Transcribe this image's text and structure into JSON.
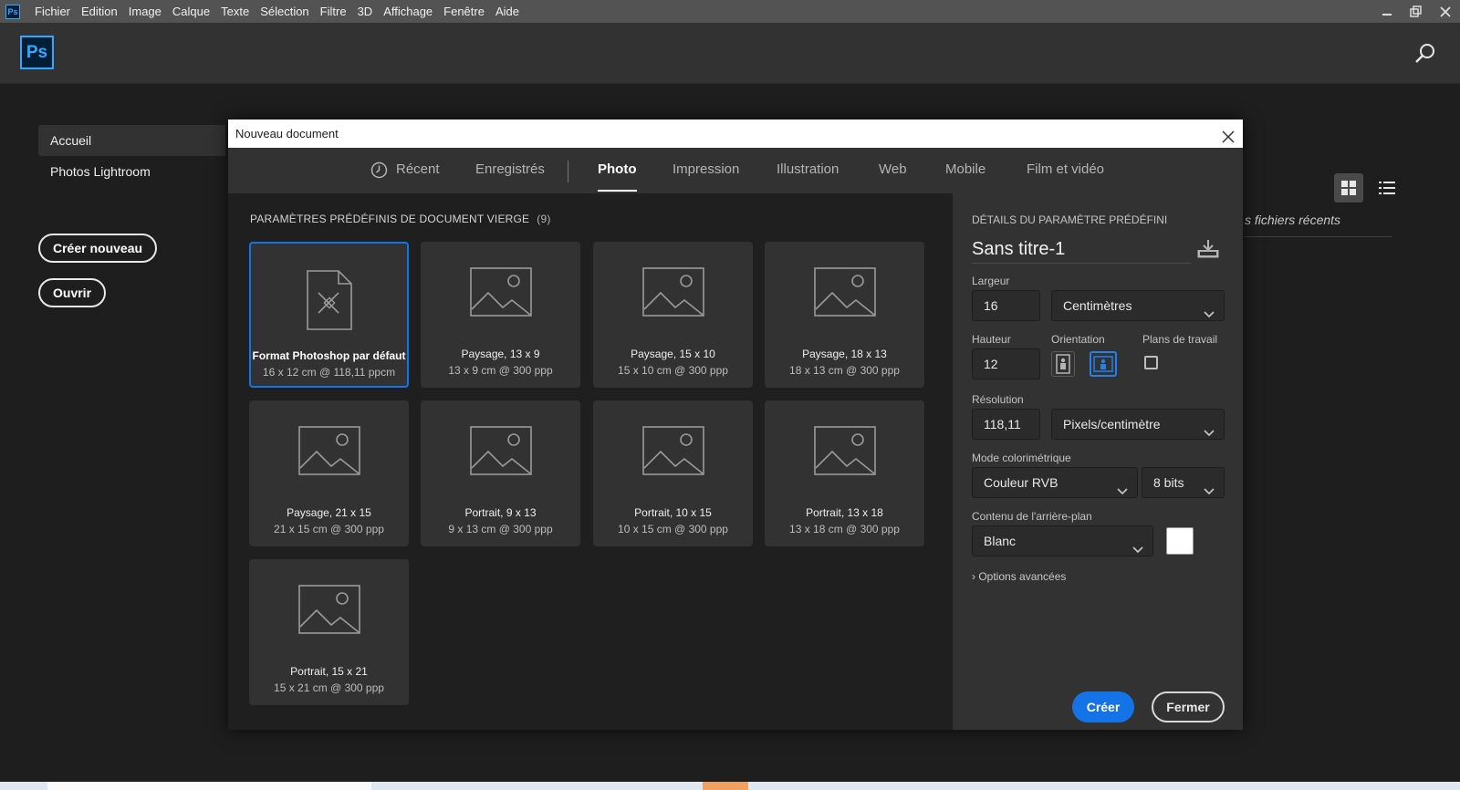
{
  "menubar": {
    "items": [
      "Fichier",
      "Edition",
      "Image",
      "Calque",
      "Texte",
      "Sélection",
      "Filtre",
      "3D",
      "Affichage",
      "Fenêtre",
      "Aide"
    ]
  },
  "app": {
    "logo_text": "Ps",
    "app_icon_text": "Ps"
  },
  "home": {
    "sidebar_items": [
      "Accueil",
      "Photos Lightroom"
    ],
    "create_new_label": "Créer nouveau",
    "open_label": "Ouvrir",
    "recent_files_label": "s fichiers récents"
  },
  "dialog": {
    "title": "Nouveau document",
    "tabs": [
      "Récent",
      "Enregistrés",
      "Photo",
      "Impression",
      "Illustration",
      "Web",
      "Mobile",
      "Film et vidéo"
    ],
    "active_tab": "Photo",
    "presets_heading": "PARAMÈTRES PRÉDÉFINIS DE DOCUMENT VIERGE",
    "presets_count": "(9)",
    "presets": [
      {
        "name": "Format Photoshop par défaut",
        "desc": "16 x 12 cm @ 118,11 ppcm",
        "icon": "document-icon",
        "selected": true
      },
      {
        "name": "Paysage, 13 x 9",
        "desc": "13 x 9 cm @ 300 ppp",
        "icon": "image-icon"
      },
      {
        "name": "Paysage, 15 x 10",
        "desc": "15 x 10 cm @ 300 ppp",
        "icon": "image-icon"
      },
      {
        "name": "Paysage, 18 x 13",
        "desc": "18 x 13 cm @ 300 ppp",
        "icon": "image-icon"
      },
      {
        "name": "Paysage, 21 x 15",
        "desc": "21 x 15 cm @ 300 ppp",
        "icon": "image-icon"
      },
      {
        "name": "Portrait, 9 x 13",
        "desc": "9 x 13 cm @ 300 ppp",
        "icon": "image-icon"
      },
      {
        "name": "Portrait, 10 x 15",
        "desc": "10 x 15 cm @ 300 ppp",
        "icon": "image-icon"
      },
      {
        "name": "Portrait, 13 x 18",
        "desc": "13 x 18 cm @ 300 ppp",
        "icon": "image-icon"
      },
      {
        "name": "Portrait, 15 x 21",
        "desc": "15 x 21 cm @ 300 ppp",
        "icon": "image-icon"
      }
    ],
    "details": {
      "heading": "DÉTAILS DU PARAMÈTRE PRÉDÉFINI",
      "doc_name": "Sans titre-1",
      "width_label": "Largeur",
      "width_value": "16",
      "width_unit": "Centimètres",
      "height_label": "Hauteur",
      "height_value": "12",
      "orientation_label": "Orientation",
      "artboards_label": "Plans de travail",
      "resolution_label": "Résolution",
      "resolution_value": "118,11",
      "resolution_unit": "Pixels/centimètre",
      "color_mode_label": "Mode colorimétrique",
      "color_mode_value": "Couleur RVB",
      "bit_depth_value": "8 bits",
      "background_label": "Contenu de l'arrière-plan",
      "background_value": "Blanc",
      "background_color": "#ffffff",
      "advanced_label": "Options avancées"
    },
    "create_label": "Créer",
    "close_label": "Fermer"
  },
  "colors": {
    "accent": "#1473e6",
    "ps_blue": "#31a8ff",
    "ps_dark": "#001e36"
  }
}
